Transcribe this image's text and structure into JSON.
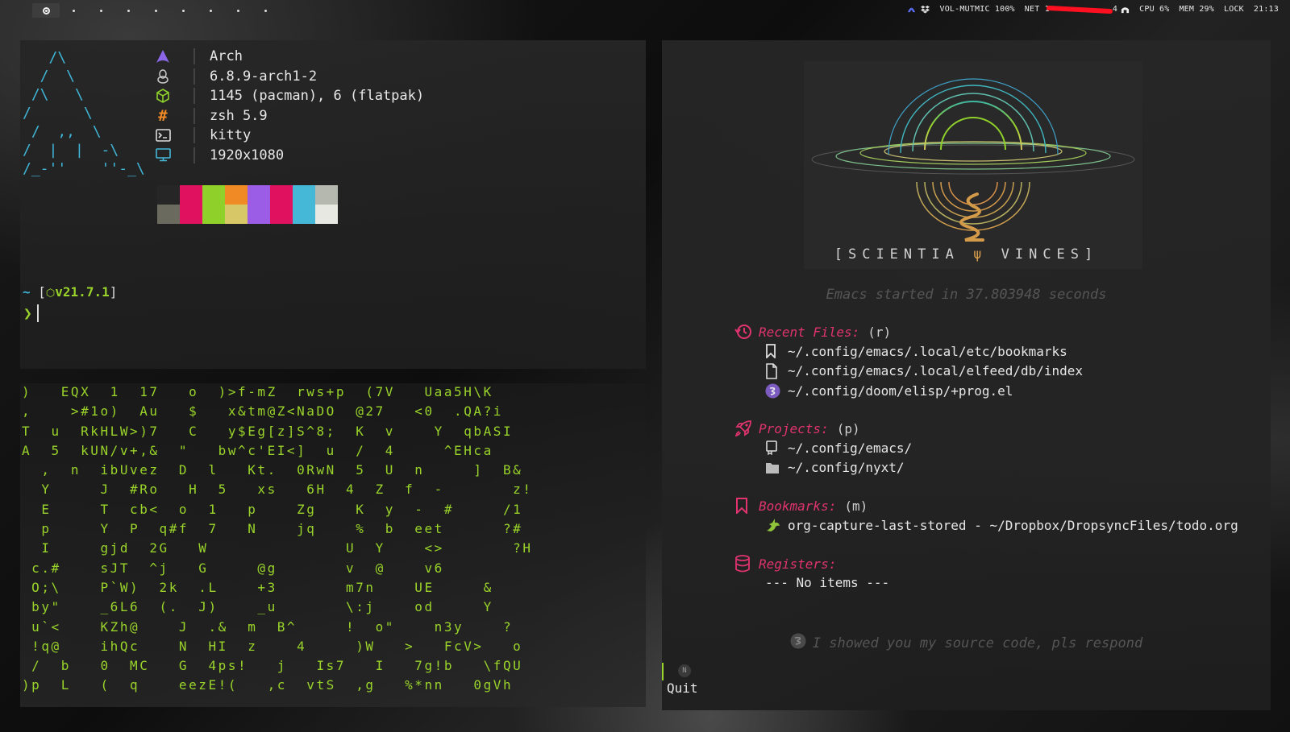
{
  "topbar": {
    "status": {
      "volume": "VOL-MUTMIC 100%",
      "net_label": "NET 1",
      "net_tail": "4",
      "cpu": "CPU 6%",
      "mem": "MEM 29%",
      "lock": "LOCK",
      "clock": "21:13"
    }
  },
  "fetch": {
    "ascii_logo": "   /\\\n  /  \\\n /\\   \\\n/      \\\n /  ,,  \\\n/  |  |  -\\\n/_-''    ''-_\\",
    "info": [
      {
        "icon": "arch-icon",
        "text": "Arch"
      },
      {
        "icon": "linux-icon",
        "text": "6.8.9-arch1-2"
      },
      {
        "icon": "package-icon",
        "text": "1145 (pacman), 6 (flatpak)"
      },
      {
        "icon": "hash-icon",
        "text": "zsh 5.9"
      },
      {
        "icon": "terminal-icon",
        "text": "kitty"
      },
      {
        "icon": "monitor-icon",
        "text": "1920x1080"
      }
    ],
    "palette_top": [
      "#262626",
      "#e0115f",
      "#8fd12a",
      "#f08a24",
      "#9b5de5",
      "#e0115f",
      "#45b8d8",
      "#b5b8ae"
    ],
    "palette_bottom": [
      "#6a6a5e",
      "#e0115f",
      "#8fd12a",
      "#d7c766",
      "#9b5de5",
      "#e0115f",
      "#45b8d8",
      "#e8e8e2"
    ],
    "prompt": {
      "tilde": "~",
      "open": "[",
      "version": "v21.7.1",
      "close": "]",
      "arrow": "❯"
    }
  },
  "matrix_lines": [
    ")   EQX  1  17   o  )>f-mZ  rws+p  (7V   Uaa5H\\K",
    ",    >#1o)  Au   $   x&tm@Z<NaDO  @27   <0  .QA?i",
    "T  u  RkHLW>)7   C   y$Eg[z]S^8;  K  v    Y  qbASI",
    "A  5  kUN/v+,&  \"   bw^c'EI<]  u  /  4     ^EHca",
    "  ,  n  ibUvez  D  l   Kt.  0RwN  5  U  n     ]  B&",
    "  Y     J  #Ro   H  5   xs   6H  4  Z  f  -       z!",
    "  E     T  cb<  o  1   p    Zg    K  y  -  #     /1",
    "  p     Y  P  q#f  7   N    jq    %  b  eet      ?#",
    "  I     gjd  2G   W              U  Y    <>       ?H",
    " c.#    sJT  ^j   G     @g       v  @    v6",
    " O;\\    P`W)  2k  .L    +3       m7n    UE     &",
    " by\"    _6L6  (.  J)    _u       \\:j    od     Y",
    " u`<    KZh@    J  .&  m  B^     !  o\"    n3y    ?",
    " !q@    ihQc    N  HI  z    4     )W   >   FcV>   o",
    " /  b   0  MC   G  4ps!   j   Is7   I   7g!b   \\fQU",
    ")p  L   (  q    eezE!(   ,c  vtS  ,g   %*nn   0gVh"
  ],
  "emacs": {
    "tagline_left": "[SCIENTIA",
    "tagline_right": "VINCES]",
    "startup": "Emacs started in 37.803948 seconds",
    "recent": {
      "title": "Recent Files:",
      "key": "(r)",
      "items": [
        "~/.config/emacs/.local/etc/bookmarks",
        "~/.config/emacs/.local/elfeed/db/index",
        "~/.config/doom/elisp/+prog.el"
      ]
    },
    "projects": {
      "title": "Projects:",
      "key": "(p)",
      "items": [
        "~/.config/emacs/",
        "~/.config/nyxt/"
      ]
    },
    "bookmarks": {
      "title": "Bookmarks:",
      "key": "(m)",
      "items": [
        "org-capture-last-stored - ~/Dropbox/DropsyncFiles/todo.org"
      ]
    },
    "registers": {
      "title": "Registers:",
      "empty": "--- No items ---"
    },
    "quote": "I showed you my source code, pls respond",
    "modeline_badge": "N",
    "minibuffer": "Quit"
  }
}
